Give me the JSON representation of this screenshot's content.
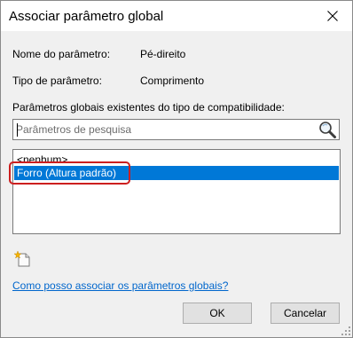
{
  "window": {
    "title": "Associar parâmetro global",
    "close_icon": "close-icon"
  },
  "fields": {
    "name_label": "Nome do parâmetro:",
    "name_value": "Pé-direito",
    "type_label": "Tipo de parâmetro:",
    "type_value": "Comprimento"
  },
  "list_section": {
    "label": "Parâmetros globais existentes do tipo de compatibilidade:",
    "search_placeholder": "Parâmetros de pesquisa",
    "search_value": "",
    "items": [
      {
        "label": "<nenhum>",
        "selected": false
      },
      {
        "label": "Forro (Altura padrão)",
        "selected": true
      }
    ],
    "selection_color": "#0078d7",
    "highlight_color": "#cc1f1f"
  },
  "toolbar": {
    "new_parameter_icon": "new-parameter-icon"
  },
  "help": {
    "link_text": "Como posso associar os parâmetros globais?",
    "link_color": "#0066cc"
  },
  "buttons": {
    "ok": "OK",
    "cancel": "Cancelar"
  }
}
